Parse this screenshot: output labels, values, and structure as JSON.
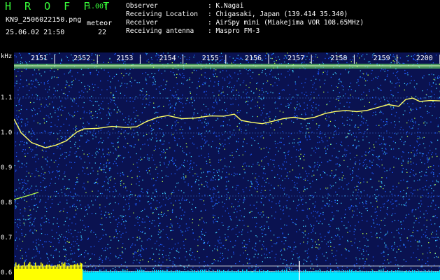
{
  "header": {
    "app_title": "H R O F F T",
    "version": "1.00f",
    "filename": "KN9_2506022150.png",
    "meteor_label": "meteor",
    "datetime": "25.06.02 21:50",
    "meteor_count": "22"
  },
  "info": [
    {
      "label": "Observer",
      "value": ": K.Nagai"
    },
    {
      "label": "Receiving Location",
      "value": ": Chigasaki, Japan (139.414 35.340)"
    },
    {
      "label": "Receiver",
      "value": ": AirSpy mini (Miakejima VOR 108.65MHz)"
    },
    {
      "label": "Receiving antenna",
      "value": ": Maspro FM-3"
    }
  ],
  "spectrogram": {
    "y_unit": "kHz",
    "y_ticks": [
      "1.1",
      "1.0",
      "0.9",
      "0.8",
      "0.7",
      "0.6"
    ],
    "y_tick_values": [
      1.1,
      1.0,
      0.9,
      0.8,
      0.7,
      0.6
    ],
    "y_range": [
      0.58,
      1.23
    ],
    "time_labels": [
      "2151",
      "2152",
      "2153",
      "2154",
      "2155",
      "2156",
      "2157",
      "2158",
      "2159",
      "2200"
    ],
    "colors": {
      "background": "#0a1250",
      "noise_low": "#1e5cff",
      "noise_mid": "#3fd0ff",
      "noise_high": "#b8ff4a",
      "trace": "#ffff66",
      "carrier": "#7cff6a",
      "bottom_left_band": "#ffff00",
      "bottom_right_band": "#00e5ff",
      "marker": "#ffffff"
    }
  }
}
